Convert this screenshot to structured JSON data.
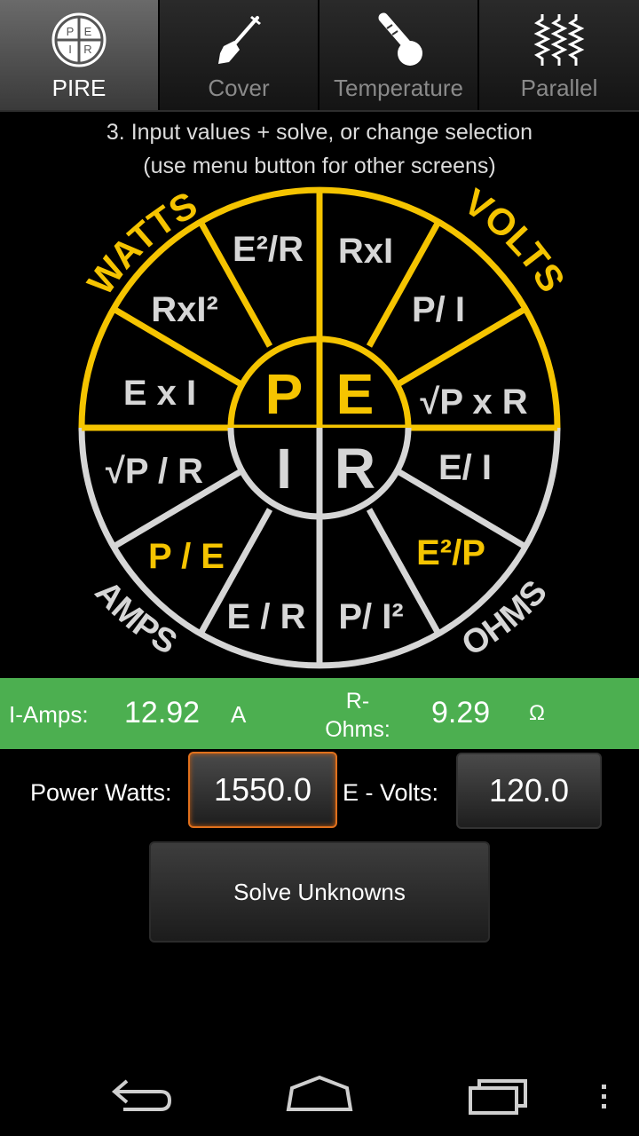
{
  "tabs": [
    {
      "label": "PIRE",
      "active": true,
      "icon": "pire-wheel-icon"
    },
    {
      "label": "Cover",
      "active": false,
      "icon": "shovel-icon"
    },
    {
      "label": "Temperature",
      "active": false,
      "icon": "thermometer-icon"
    },
    {
      "label": "Parallel",
      "active": false,
      "icon": "resistors-icon"
    }
  ],
  "pire_icon_letters": [
    "P",
    "E",
    "I",
    "R"
  ],
  "instructions": {
    "line1": "3. Input values + solve, or change selection",
    "line2": "(use menu button for other screens)"
  },
  "wheel": {
    "quadrant_titles": {
      "watts": "WATTS",
      "volts": "VOLTS",
      "amps": "AMPS",
      "ohms": "OHMS"
    },
    "center_letters": {
      "p": "P",
      "e": "E",
      "i": "I",
      "r": "R"
    },
    "formulas": {
      "watts": [
        "E x I",
        "RxI²",
        "E²/R"
      ],
      "volts": [
        "RxI",
        "P/ I",
        "√P x R"
      ],
      "amps": [
        "√P / R",
        "P / E",
        "E / R"
      ],
      "ohms": [
        "P/ I²",
        "E²/P",
        "E/ I"
      ]
    },
    "active_color": "#f5c400",
    "inactive_color": "#d6d6d6",
    "highlighted": [
      "watts",
      "volts",
      "P / E",
      "E²/P"
    ]
  },
  "results": {
    "amps_label": "I-Amps:",
    "amps_value": "12.92",
    "amps_unit": "A",
    "ohms_label_line1": "R-",
    "ohms_label_line2": "Ohms:",
    "ohms_value": "9.29",
    "ohms_unit": "Ω",
    "bar_color": "#4caf50"
  },
  "inputs": {
    "power_label": "Power Watts:",
    "power_value": "1550.0",
    "volts_label": "E - Volts:",
    "volts_value": "120.0"
  },
  "solve_label": "Solve Unknowns",
  "navbar": [
    "back-icon",
    "home-icon",
    "recent-apps-icon",
    "overflow-menu-icon"
  ]
}
